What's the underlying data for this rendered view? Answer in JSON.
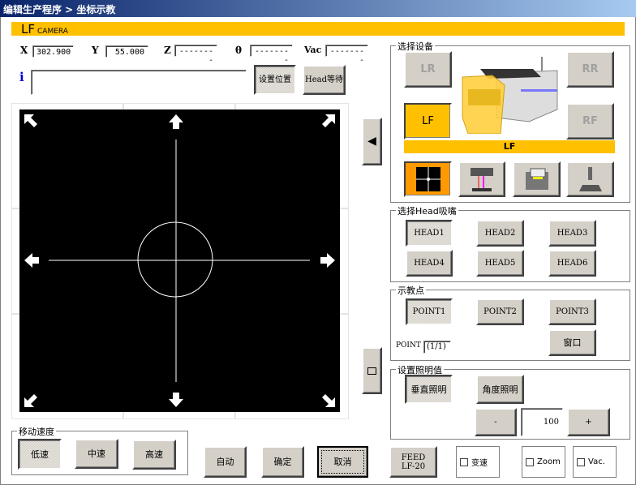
{
  "title": "编辑生产程序 > 坐标示教",
  "camera_bar": {
    "big": "LF",
    "small": "CAMERA",
    "color": "#ffc000"
  },
  "coords": {
    "x_label": "X",
    "x": "302.900",
    "y_label": "Y",
    "y": "55.000",
    "z_label": "Z",
    "z": "--------",
    "t_label": "θ",
    "t": "--------",
    "vac_label": "Vac",
    "vac": "--------"
  },
  "info": {
    "icon": "i",
    "value": ""
  },
  "buttons": {
    "set_pos": "设置位置",
    "head_wait": "Head等待",
    "auto": "自动",
    "ok": "确定",
    "cancel": "取消",
    "feed": "FEED LF-20"
  },
  "device": {
    "title": "选择设备",
    "lr": "LR",
    "rr": "RR",
    "lf": "LF",
    "rf": "RF",
    "selected": "LF"
  },
  "heads": {
    "title": "选择Head吸嘴",
    "items": [
      "HEAD1",
      "HEAD2",
      "HEAD3",
      "HEAD4",
      "HEAD5",
      "HEAD6"
    ]
  },
  "points": {
    "title": "示教点",
    "items": [
      "POINT1",
      "POINT2",
      "POINT3"
    ],
    "window": "窗口",
    "point_label": "POINT",
    "point_value": "(1/1)"
  },
  "light": {
    "title": "设置照明值",
    "vertical": "垂直照明",
    "angle": "角度照明",
    "minus": "-",
    "plus": "+",
    "value": "100"
  },
  "speed": {
    "title": "移动速度",
    "low": "低速",
    "mid": "中速",
    "high": "高速"
  },
  "checks": {
    "speed": "变速",
    "zoom": "Zoom",
    "vac": "Vac."
  }
}
